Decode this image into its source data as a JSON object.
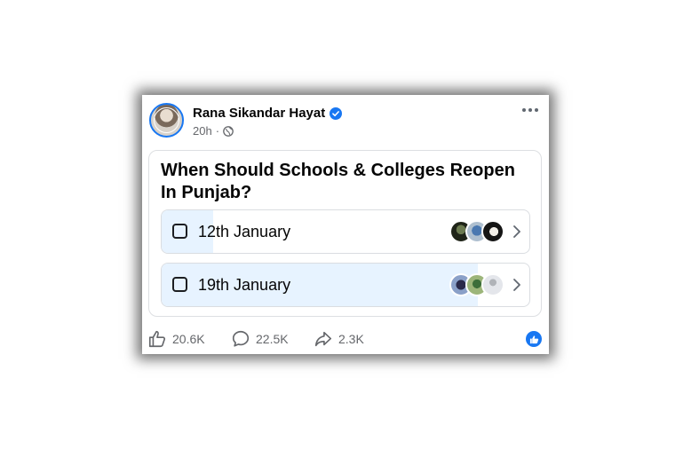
{
  "post": {
    "author": "Rana Sikandar Hayat",
    "time": "20h",
    "separator": "·"
  },
  "poll": {
    "question": "When Should Schools & Colleges Reopen In Punjab?",
    "options": [
      {
        "label": "12th January",
        "vote_share": 0.14
      },
      {
        "label": "19th January",
        "vote_share": 0.86
      }
    ]
  },
  "actions": {
    "likes": "20.6K",
    "comments": "22.5K",
    "shares": "2.3K"
  },
  "icons": {
    "verified": "verified-badge-icon",
    "privacy": "globe-icon",
    "more": "more-options-icon",
    "like": "thumbs-up-icon",
    "comment": "comment-bubble-icon",
    "share": "share-arrow-icon"
  },
  "colors": {
    "accent": "#1877f2",
    "poll_fill": "#e7f3ff",
    "secondary_text": "#65676b"
  }
}
